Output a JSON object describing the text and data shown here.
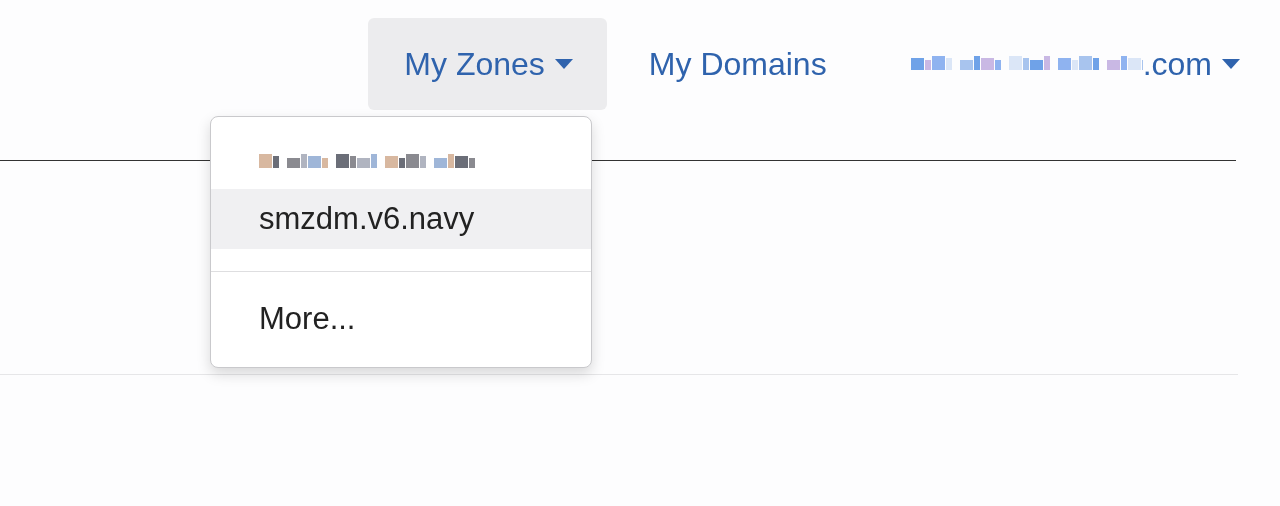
{
  "nav": [
    {
      "kind": "menu",
      "label": "My Zones",
      "expanded": true
    },
    {
      "kind": "link",
      "label": "My Domains"
    },
    {
      "kind": "account",
      "label": ".com"
    }
  ],
  "zones_menu": {
    "items": [
      {
        "kind": "redacted",
        "selected": false
      },
      {
        "kind": "item",
        "label": "smzdm.v6.navy",
        "selected": true
      }
    ],
    "footer": "More..."
  }
}
